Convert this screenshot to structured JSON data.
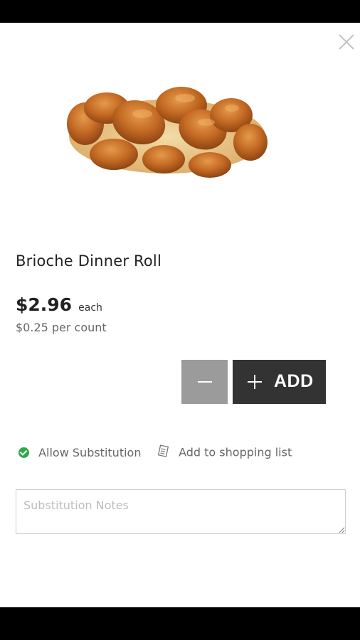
{
  "product": {
    "name": "Brioche Dinner Roll",
    "price": "$2.96",
    "price_unit": "each",
    "per_count": "$0.25 per count",
    "image_alt": "braided-brioche-loaf"
  },
  "actions": {
    "add_label": "ADD",
    "allow_substitution_label": "Allow Substitution",
    "add_to_list_label": "Add to shopping list"
  },
  "notes": {
    "placeholder": "Substitution Notes",
    "value": ""
  },
  "colors": {
    "add_button": "#333333",
    "minus_button": "#9b9b9b",
    "check_green": "#2eaa4b"
  },
  "icons": [
    "close-icon",
    "minus-icon",
    "plus-icon",
    "check-circle-icon",
    "shopping-list-icon"
  ]
}
